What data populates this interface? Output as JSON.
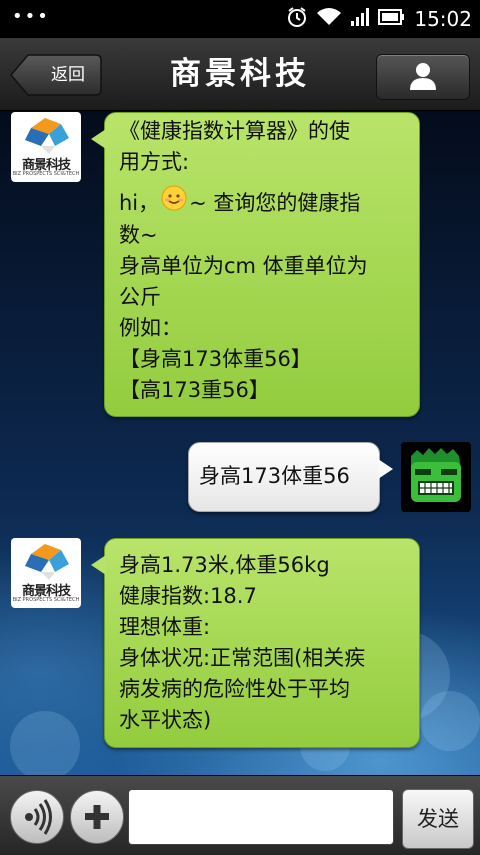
{
  "status_bar": {
    "time": "15:02",
    "icons": [
      "notification-dots",
      "alarm-icon",
      "wifi-icon",
      "signal-icon",
      "battery-icon"
    ]
  },
  "header": {
    "back_label": "返回",
    "title": "商景科技",
    "profile_icon": "person-icon"
  },
  "messages": [
    {
      "from": "company",
      "avatar": {
        "text": "商景科技",
        "subtext": "BIZ PROSPECTS SCI&TECH"
      },
      "lines": [
        "《健康指数计算器》的使",
        "用方式:",
        "",
        "hi，",
        "~ 查询您的健康指",
        "数~",
        "身高单位为cm 体重单位为",
        "公斤",
        "例如：",
        "【身高173体重56】",
        "【高173重56】"
      ],
      "emoji": "smile-emoji"
    },
    {
      "from": "user",
      "avatar": {
        "icon": "hulk-face-icon"
      },
      "lines": [
        "身高173体重56"
      ]
    },
    {
      "from": "company",
      "avatar": {
        "text": "商景科技",
        "subtext": "BIZ PROSPECTS SCI&TECH"
      },
      "lines": [
        "身高1.73米,体重56kg",
        "健康指数:18.7",
        "理想体重:",
        "身体状况:正常范围(相关疾",
        "病发病的危险性处于平均",
        "水平状态)"
      ]
    }
  ],
  "input_bar": {
    "voice_icon": "voice-icon",
    "add_icon": "plus-icon",
    "input_value": "",
    "send_label": "发送"
  },
  "colors": {
    "bubble_green": "#a6d853",
    "bubble_white": "#f2f2f2",
    "titlebar": "#2a2a2a"
  }
}
